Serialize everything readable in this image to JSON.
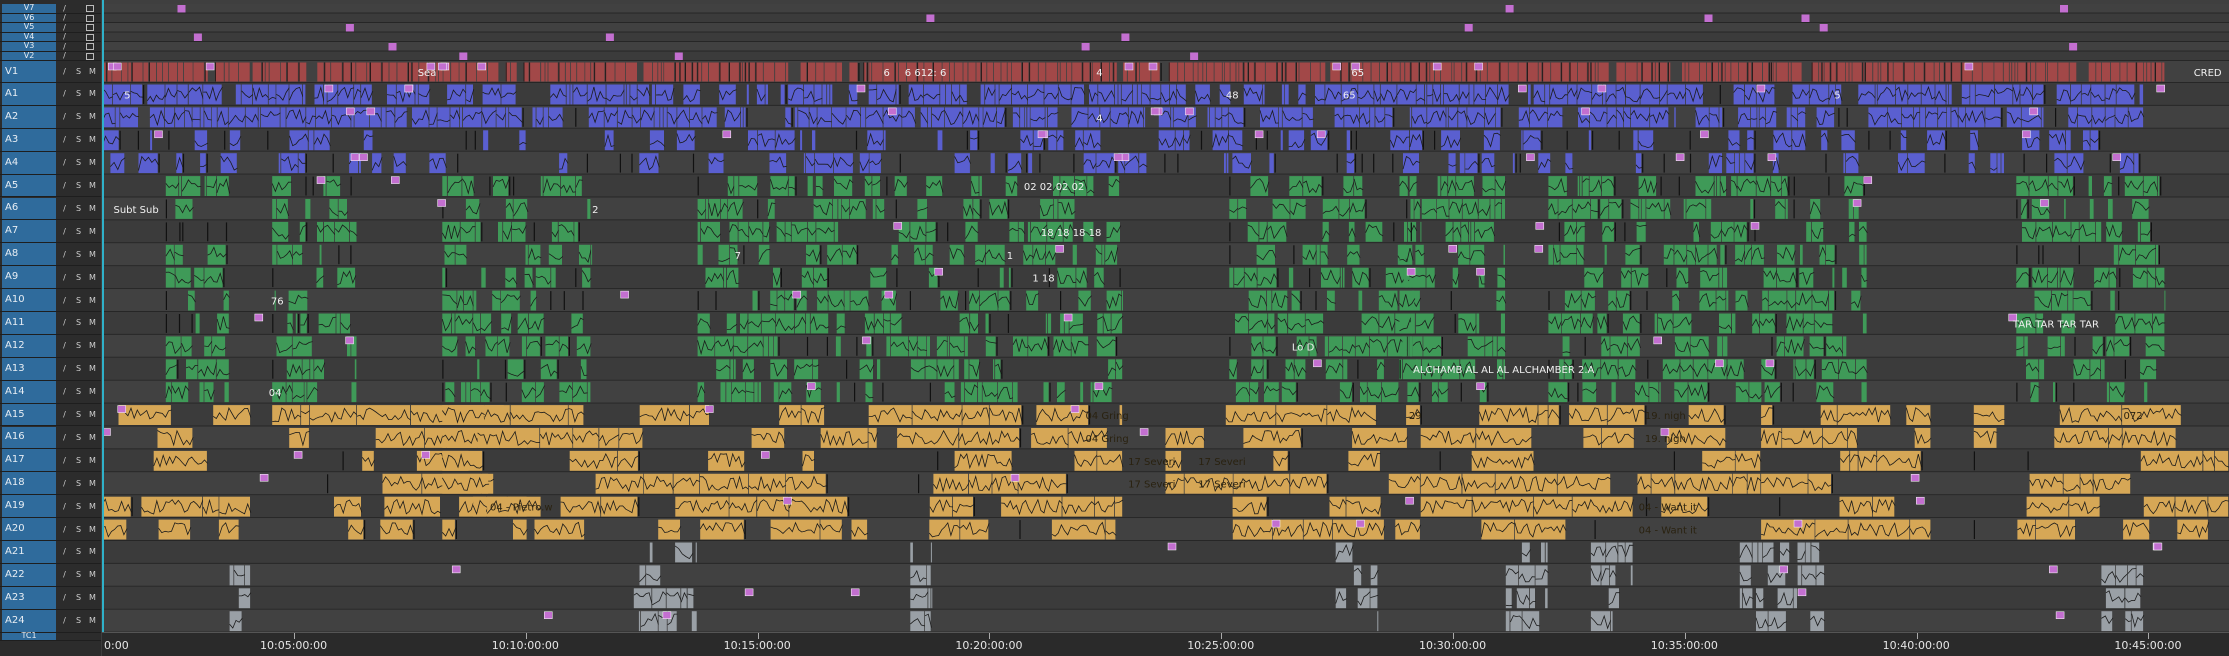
{
  "colors": {
    "video": "#a24848",
    "audio_blue": "#5a5fd0",
    "audio_green": "#3f9a58",
    "audio_gold": "#d6a756",
    "audio_grey": "#9aa0a6",
    "marker": "#c36fd0",
    "playhead": "#2fb1c9",
    "track_header": "#2f6b9c"
  },
  "tracks": [
    {
      "name": "V7",
      "kind": "video_empty"
    },
    {
      "name": "V6",
      "kind": "video_empty"
    },
    {
      "name": "V5",
      "kind": "video_empty"
    },
    {
      "name": "V4",
      "kind": "video_empty"
    },
    {
      "name": "V3",
      "kind": "video_empty"
    },
    {
      "name": "V2",
      "kind": "video_empty"
    },
    {
      "name": "V1",
      "kind": "video"
    },
    {
      "name": "A1",
      "kind": "blue"
    },
    {
      "name": "A2",
      "kind": "blue"
    },
    {
      "name": "A3",
      "kind": "blue"
    },
    {
      "name": "A4",
      "kind": "blue"
    },
    {
      "name": "A5",
      "kind": "green"
    },
    {
      "name": "A6",
      "kind": "green"
    },
    {
      "name": "A7",
      "kind": "green"
    },
    {
      "name": "A8",
      "kind": "green"
    },
    {
      "name": "A9",
      "kind": "green"
    },
    {
      "name": "A10",
      "kind": "green"
    },
    {
      "name": "A11",
      "kind": "green"
    },
    {
      "name": "A12",
      "kind": "green"
    },
    {
      "name": "A13",
      "kind": "green"
    },
    {
      "name": "A14",
      "kind": "green"
    },
    {
      "name": "A15",
      "kind": "gold"
    },
    {
      "name": "A16",
      "kind": "gold"
    },
    {
      "name": "A17",
      "kind": "gold"
    },
    {
      "name": "A18",
      "kind": "gold"
    },
    {
      "name": "A19",
      "kind": "gold"
    },
    {
      "name": "A20",
      "kind": "gold"
    },
    {
      "name": "A21",
      "kind": "grey"
    },
    {
      "name": "A22",
      "kind": "grey"
    },
    {
      "name": "A23",
      "kind": "grey"
    },
    {
      "name": "A24",
      "kind": "grey"
    },
    {
      "name": "TC1",
      "kind": "tc"
    }
  ],
  "track_button_labels": {
    "solo": "S",
    "mute": "M",
    "pencil": "/"
  },
  "ruler": {
    "start_label": "0:00",
    "labels": [
      "10:05:00:00",
      "10:10:00:00",
      "10:15:00:00",
      "10:20:00:00",
      "10:25:00:00",
      "10:30:00:00",
      "10:35:00:00",
      "10:40:00:00",
      "10:45:00:00"
    ]
  },
  "clip_labels": [
    {
      "track": "V1",
      "text": "Sea",
      "pos": 0.147
    },
    {
      "track": "V1",
      "text": "6",
      "pos": 0.366
    },
    {
      "track": "V1",
      "text": "6 612: 6",
      "pos": 0.376
    },
    {
      "track": "V1",
      "text": "4",
      "pos": 0.466
    },
    {
      "track": "V1",
      "text": "65",
      "pos": 0.586
    },
    {
      "track": "V1",
      "text": "CRED",
      "pos": 0.982
    },
    {
      "track": "A1",
      "text": "5",
      "pos": 0.009
    },
    {
      "track": "A1",
      "text": "48",
      "pos": 0.527
    },
    {
      "track": "A1",
      "text": "65",
      "pos": 0.582
    },
    {
      "track": "A1",
      "text": "5",
      "pos": 0.813
    },
    {
      "track": "A2",
      "text": "4",
      "pos": 0.466
    },
    {
      "track": "A5",
      "text": "02 02 02 02",
      "pos": 0.432
    },
    {
      "track": "A6",
      "text": "Subt Sub",
      "pos": 0.004
    },
    {
      "track": "A6",
      "text": "2",
      "pos": 0.229
    },
    {
      "track": "A7",
      "text": "18 18 18 18",
      "pos": 0.44
    },
    {
      "track": "A8",
      "text": "7",
      "pos": 0.296
    },
    {
      "track": "A8",
      "text": "1",
      "pos": 0.424
    },
    {
      "track": "A9",
      "text": "1 18",
      "pos": 0.436
    },
    {
      "track": "A10",
      "text": "76",
      "pos": 0.078
    },
    {
      "track": "A11",
      "text": "TAR TAR TAR TAR",
      "pos": 0.897
    },
    {
      "track": "A12",
      "text": "Lo D",
      "pos": 0.558
    },
    {
      "track": "A13",
      "text": "ALCHAMB AL AL AL ALCHAMBER 2.A",
      "pos": 0.615
    },
    {
      "track": "A14",
      "text": "04",
      "pos": 0.077
    },
    {
      "track": "A15",
      "text": "04 Gring",
      "pos": 0.461
    },
    {
      "track": "A15",
      "text": "29",
      "pos": 0.613
    },
    {
      "track": "A15",
      "text": "19. nigh",
      "pos": 0.724
    },
    {
      "track": "A15",
      "text": "072",
      "pos": 0.949
    },
    {
      "track": "A16",
      "text": "04 Gring",
      "pos": 0.461
    },
    {
      "track": "A16",
      "text": "19. nigh",
      "pos": 0.724
    },
    {
      "track": "A17",
      "text": "17 Severi",
      "pos": 0.481
    },
    {
      "track": "A17",
      "text": "17 Severi",
      "pos": 0.514
    },
    {
      "track": "A18",
      "text": "17 Severi",
      "pos": 0.481
    },
    {
      "track": "A18",
      "text": "17 Severi",
      "pos": 0.514
    },
    {
      "track": "A19",
      "text": "04 - Pietro.w",
      "pos": 0.181
    },
    {
      "track": "A19",
      "text": "04 - Want it",
      "pos": 0.721
    },
    {
      "track": "A20",
      "text": "04 - Want it",
      "pos": 0.721
    }
  ]
}
